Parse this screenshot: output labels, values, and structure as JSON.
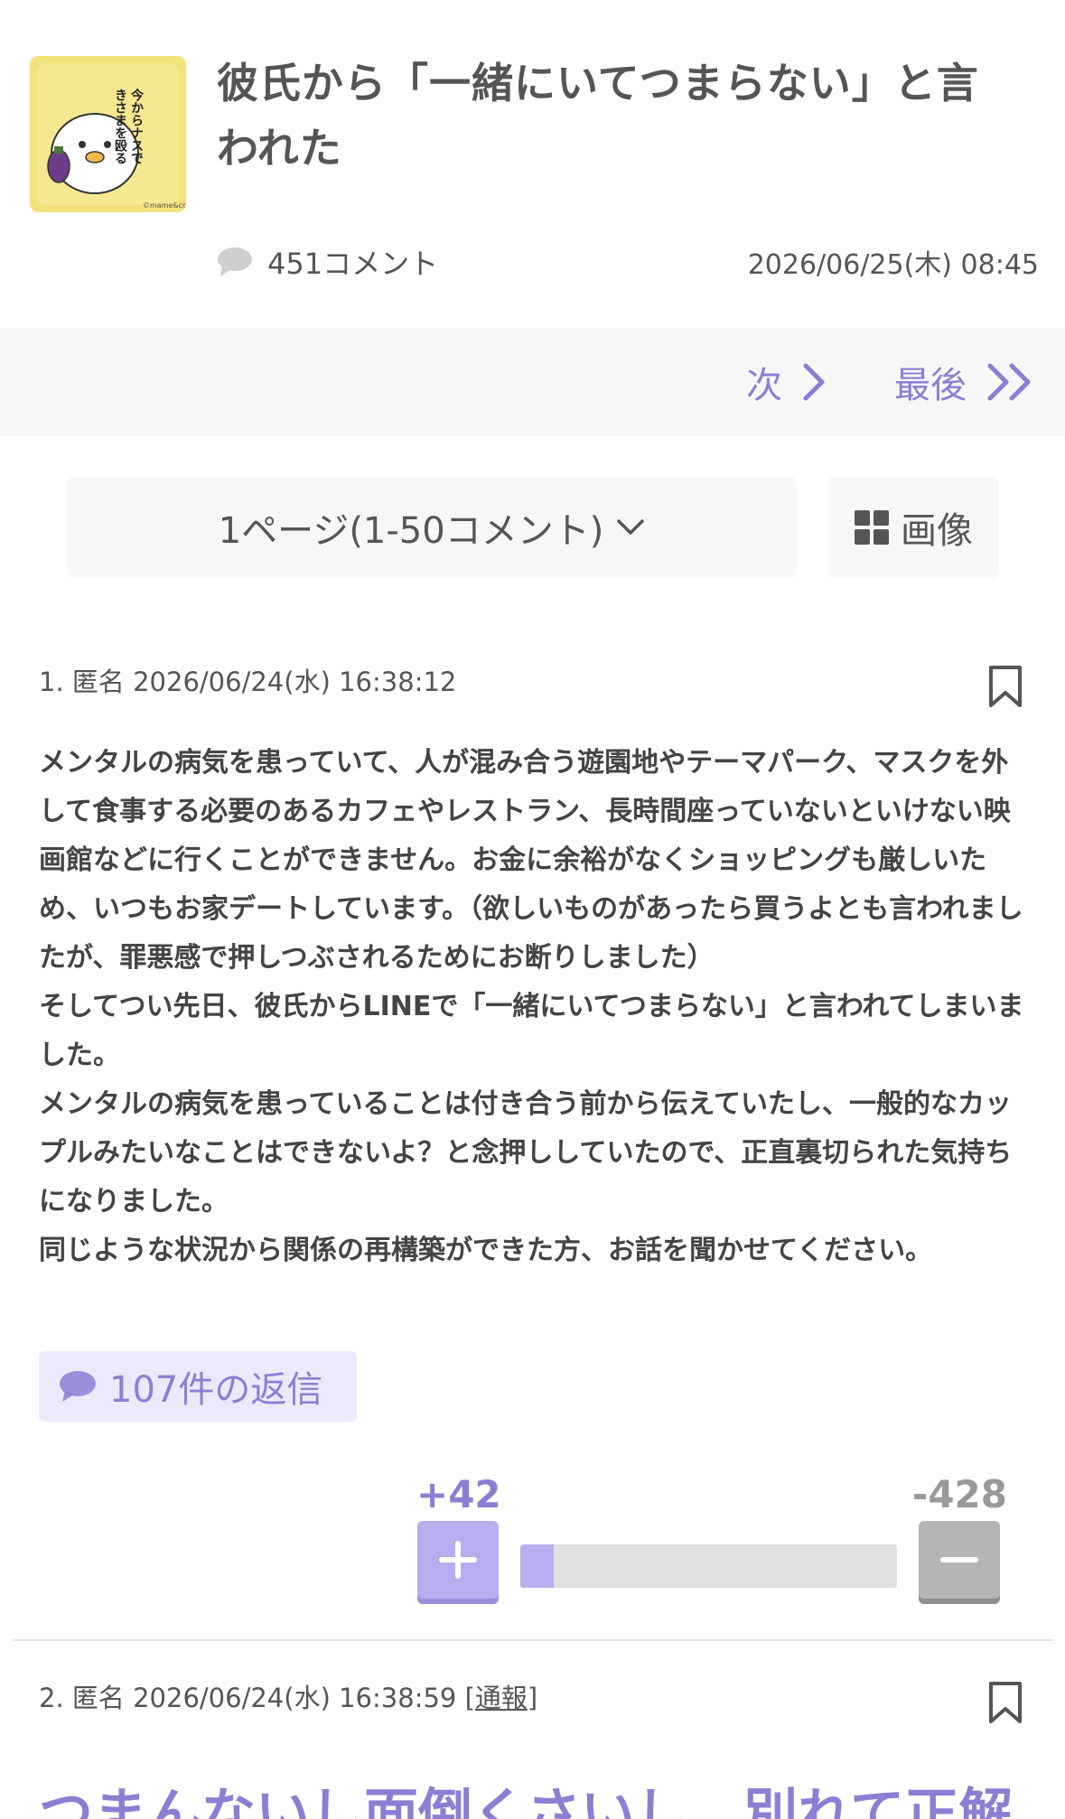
{
  "topic": {
    "title": "彼氏から「一緒にいてつまらない」と言われた",
    "thumbnail_text": "今からナスできさまを殴る",
    "thumbnail_credit": "©mame&co",
    "comment_count": "451コメント",
    "posted_at": "2026/06/25(木) 08:45"
  },
  "pager": {
    "next_label": "次",
    "last_label": "最後"
  },
  "page_select": {
    "label": "1ページ(1-50コメント)"
  },
  "image_button": {
    "label": "画像"
  },
  "comments": [
    {
      "meta": "1. 匿名 2026/06/24(水) 16:38:12",
      "body": [
        "メンタルの病気を患っていて、人が混み合う遊園地やテーマパーク、マスクを外して食事する必要のあるカフェやレストラン、長時間座っていないといけない映画館などに行くことができません。お金に余裕がなくショッピングも厳しいため、いつもお家デートしています。（欲しいものがあったら買うよとも言われましたが、罪悪感で押しつぶされるためにお断りしました）",
        "そしてつい先日、彼氏からLINEで「一緒にいてつまらない」と言われてしまいました。",
        "メンタルの病気を患っていることは付き合う前から伝えていたし、一般的なカップルみたいなことはできないよ？と念押ししていたので、正直裏切られた気持ちになりました。",
        "同じような状況から関係の再構築ができた方、お話を聞かせてください。"
      ],
      "reply_label": "107件の返信",
      "plus": "+42",
      "minus": "-428",
      "plus_ratio": 0.089
    },
    {
      "meta": "2. 匿名 2026/06/24(水) 16:38:59",
      "report": "[通報]",
      "report_text": "通報",
      "body_title": "つまんないし面倒くさいし、別れて正解"
    }
  ],
  "colors": {
    "accent": "#8b7fd4",
    "plus_button": "#b7aef0",
    "minus_button": "#b5b5b5"
  }
}
